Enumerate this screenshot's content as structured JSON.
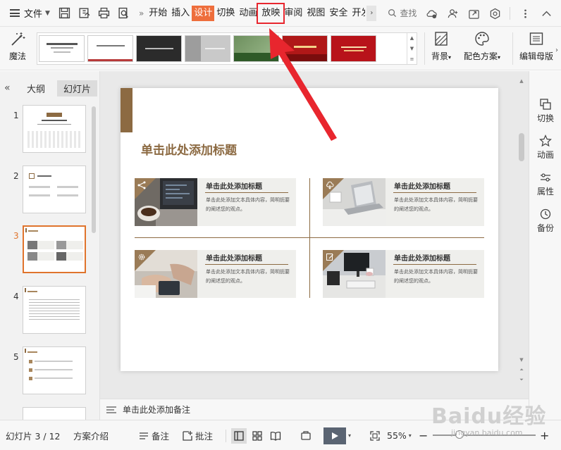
{
  "menubar": {
    "file_label": "文件",
    "tabs": [
      "开始",
      "插入",
      "设计",
      "切换",
      "动画",
      "放映",
      "审阅",
      "视图",
      "安全",
      "开发"
    ],
    "active_tab": "设计",
    "highlighted_tab": "放映",
    "search_placeholder": "查找"
  },
  "ribbon": {
    "magic_label": "魔法",
    "background_label": "背景",
    "color_scheme_label": "配色方案",
    "edit_master_label": "编辑母版",
    "themes": [
      {
        "name": "theme-1",
        "text": "",
        "bg": "#ffffff"
      },
      {
        "name": "theme-2",
        "text": "",
        "bg": "#ffffff"
      },
      {
        "name": "theme-3",
        "text": "",
        "bg": "#2b2b2b"
      },
      {
        "name": "theme-4",
        "text": "",
        "bg": "#c9c9c9"
      },
      {
        "name": "theme-5",
        "text": "",
        "bg": "#3f6b3a"
      },
      {
        "name": "theme-6",
        "text": "",
        "bg": "#b01818"
      },
      {
        "name": "theme-7",
        "text": "",
        "bg": "#b8131a"
      }
    ]
  },
  "left_panel": {
    "tab_outline": "大纲",
    "tab_slides": "幻灯片",
    "slide_numbers": [
      "1",
      "2",
      "3",
      "4",
      "5"
    ],
    "selected_slide": "3"
  },
  "slide": {
    "title": "单击此处添加标题",
    "cards": [
      {
        "title": "单击此处添加标题",
        "body": "单击此处添加文本具体内容，简明扼要的阐述您的观点。"
      },
      {
        "title": "单击此处添加标题",
        "body": "单击此处添加文本具体内容，简明扼要的阐述您的观点。"
      },
      {
        "title": "单击此处添加标题",
        "body": "单击此处添加文本具体内容，简明扼要的阐述您的观点。"
      },
      {
        "title": "单击此处添加标题",
        "body": "单击此处添加文本具体内容，简明扼要的阐述您的观点。"
      }
    ],
    "accent_color": "#8c6a42"
  },
  "notes": {
    "placeholder": "单击此处添加备注"
  },
  "right_sidebar": {
    "items": [
      "切换",
      "动画",
      "属性",
      "备份"
    ]
  },
  "status": {
    "slide_counter": "幻灯片 3 / 12",
    "theme_name": "方案介绍",
    "notes_label": "备注",
    "comment_label": "批注",
    "zoom": "55%"
  },
  "watermark": {
    "logo_text": "Baidu经验",
    "url_text": "jingyan.baidu.com"
  },
  "colors": {
    "active_tab_bg": "#ee6e3c",
    "highlight_box": "#e8262e",
    "selected_thumb": "#e0742c"
  }
}
